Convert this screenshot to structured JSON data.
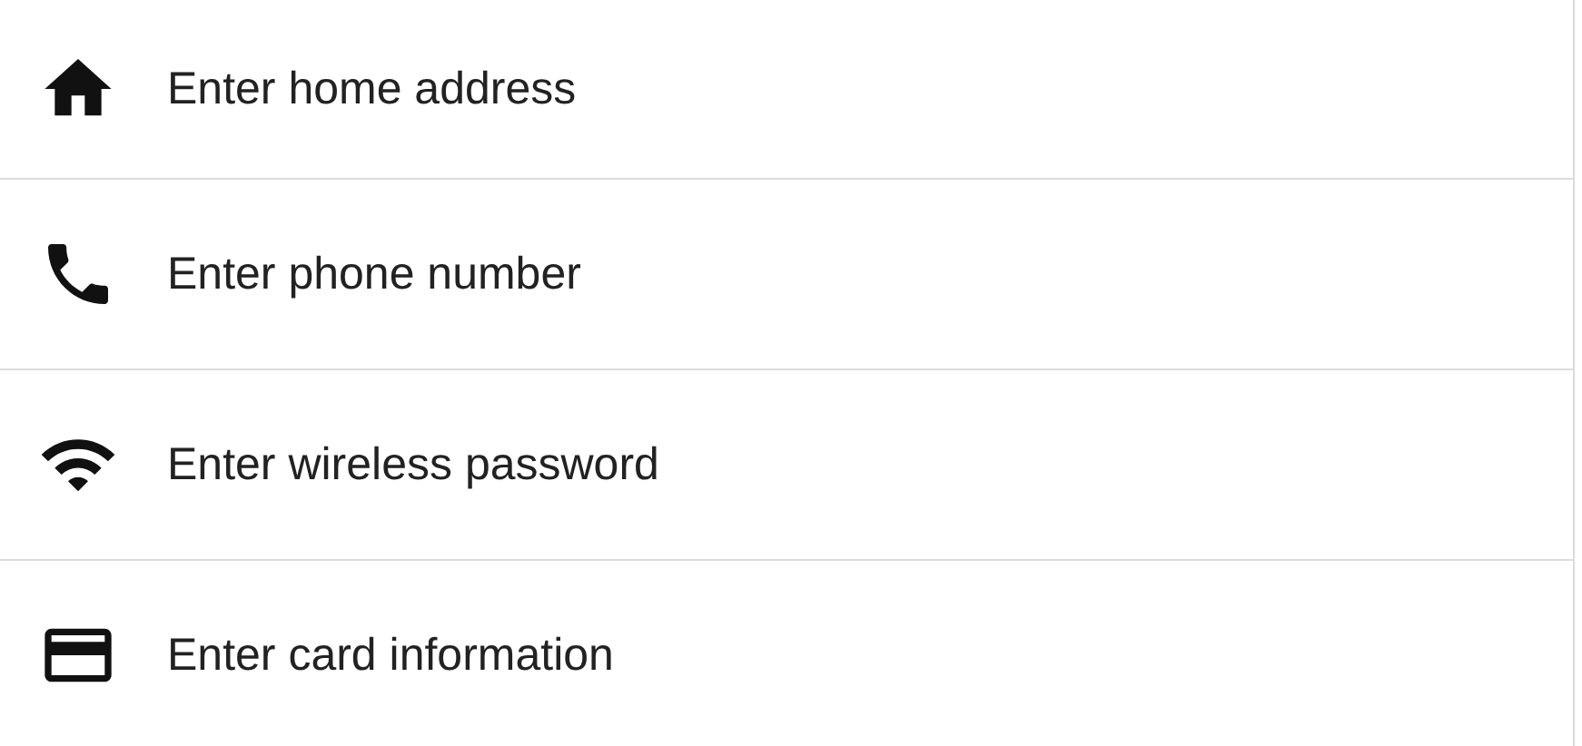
{
  "fields": [
    {
      "kind": "home",
      "placeholder": "Enter home address"
    },
    {
      "kind": "phone",
      "placeholder": "Enter phone number"
    },
    {
      "kind": "wifi",
      "placeholder": "Enter wireless password"
    },
    {
      "kind": "card",
      "placeholder": "Enter card information"
    }
  ]
}
